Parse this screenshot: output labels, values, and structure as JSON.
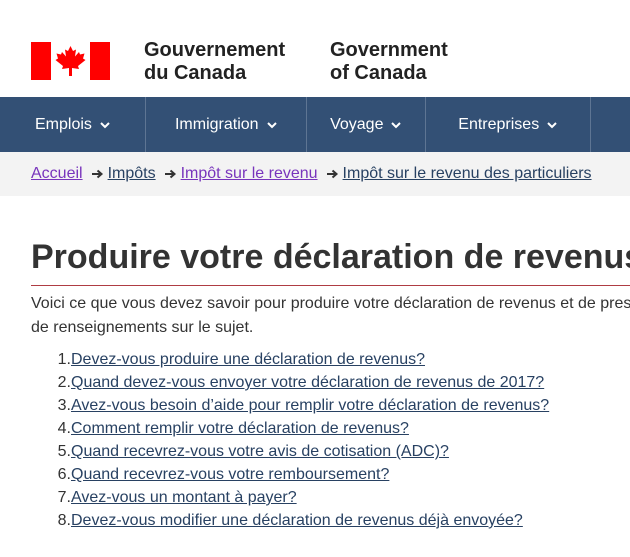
{
  "header": {
    "signature_fr_line1": "Gouvernement",
    "signature_fr_line2": "du Canada",
    "signature_en_line1": "Government",
    "signature_en_line2": "of Canada",
    "flag_color": "#ff0000"
  },
  "menu": {
    "items": [
      {
        "label": "Emplois"
      },
      {
        "label": "Immigration"
      },
      {
        "label": "Voyage"
      },
      {
        "label": "Entreprises"
      },
      {
        "label": ""
      }
    ]
  },
  "breadcrumb": {
    "items": [
      {
        "label": "Accueil"
      },
      {
        "label": "Impôts"
      },
      {
        "label": "Impôt sur le revenu"
      },
      {
        "label": "Impôt sur le revenu des particuliers"
      }
    ]
  },
  "main": {
    "title": "Produire votre déclaration de revenus",
    "intro_line1": "Voici ce que vous devez savoir pour produire votre déclaration de revenus et de pres",
    "intro_line2": "de renseignements sur le sujet.",
    "toc": [
      {
        "num": "1.",
        "label": "Devez-vous produire une déclaration de revenus?"
      },
      {
        "num": "2.",
        "label": "Quand devez-vous envoyer votre déclaration de revenus de 2017?"
      },
      {
        "num": "3.",
        "label": "Avez-vous besoin d’aide pour remplir votre déclaration de revenus?"
      },
      {
        "num": "4.",
        "label": "Comment remplir votre déclaration de revenus?"
      },
      {
        "num": "5.",
        "label": "Quand recevrez-vous votre avis de cotisation (ADC)?"
      },
      {
        "num": "6.",
        "label": "Quand recevrez-vous votre remboursement?"
      },
      {
        "num": "7.",
        "label": "Avez-vous un montant à payer?"
      },
      {
        "num": "8.",
        "label": "Devez-vous modifier une déclaration de revenus déjà envoyée?"
      }
    ]
  },
  "colors": {
    "menu_bg": "#335075",
    "link": "#284162",
    "visited_link": "#7834bc",
    "title_rule": "#af3c43",
    "breadcrumb_bg": "#f3f3f3"
  }
}
